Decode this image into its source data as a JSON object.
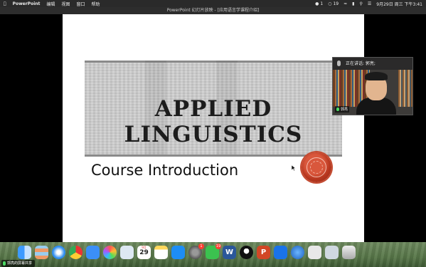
{
  "menubar": {
    "app_name": "PowerPoint",
    "menus": [
      "编辑",
      "视图",
      "窗口",
      "帮助"
    ],
    "status": {
      "notifications_count": "1",
      "wechat_count": "19",
      "datetime": "9月29日 周三 下午3:41"
    }
  },
  "window": {
    "title": "PowerPoint 幻灯片放映 - [应用语言学课程介绍]"
  },
  "slide": {
    "title": "Applied Linguistics",
    "subtitle": "Course Introduction"
  },
  "video_panel": {
    "speaking_label": "正在讲话: 郭亮;",
    "participant_name": "郭亮"
  },
  "dock": {
    "calendar": {
      "month": "9月",
      "day": "29"
    },
    "badges": {
      "system_prefs": "1",
      "wechat": "19"
    },
    "icons": [
      "finder-icon",
      "launchpad-icon",
      "safari-icon",
      "chrome-icon",
      "mail-icon",
      "photos-icon",
      "preview-icon",
      "calendar-icon",
      "notes-icon",
      "appstore-icon",
      "system-preferences-icon",
      "wechat-icon",
      "word-icon",
      "qq-icon",
      "powerpoint-icon",
      "tencent-meeting-icon",
      "network-icon",
      "screenshot-icon",
      "display-icon",
      "trash-icon"
    ]
  },
  "share_indicator": {
    "label": "郭亮的屏幕共享"
  }
}
